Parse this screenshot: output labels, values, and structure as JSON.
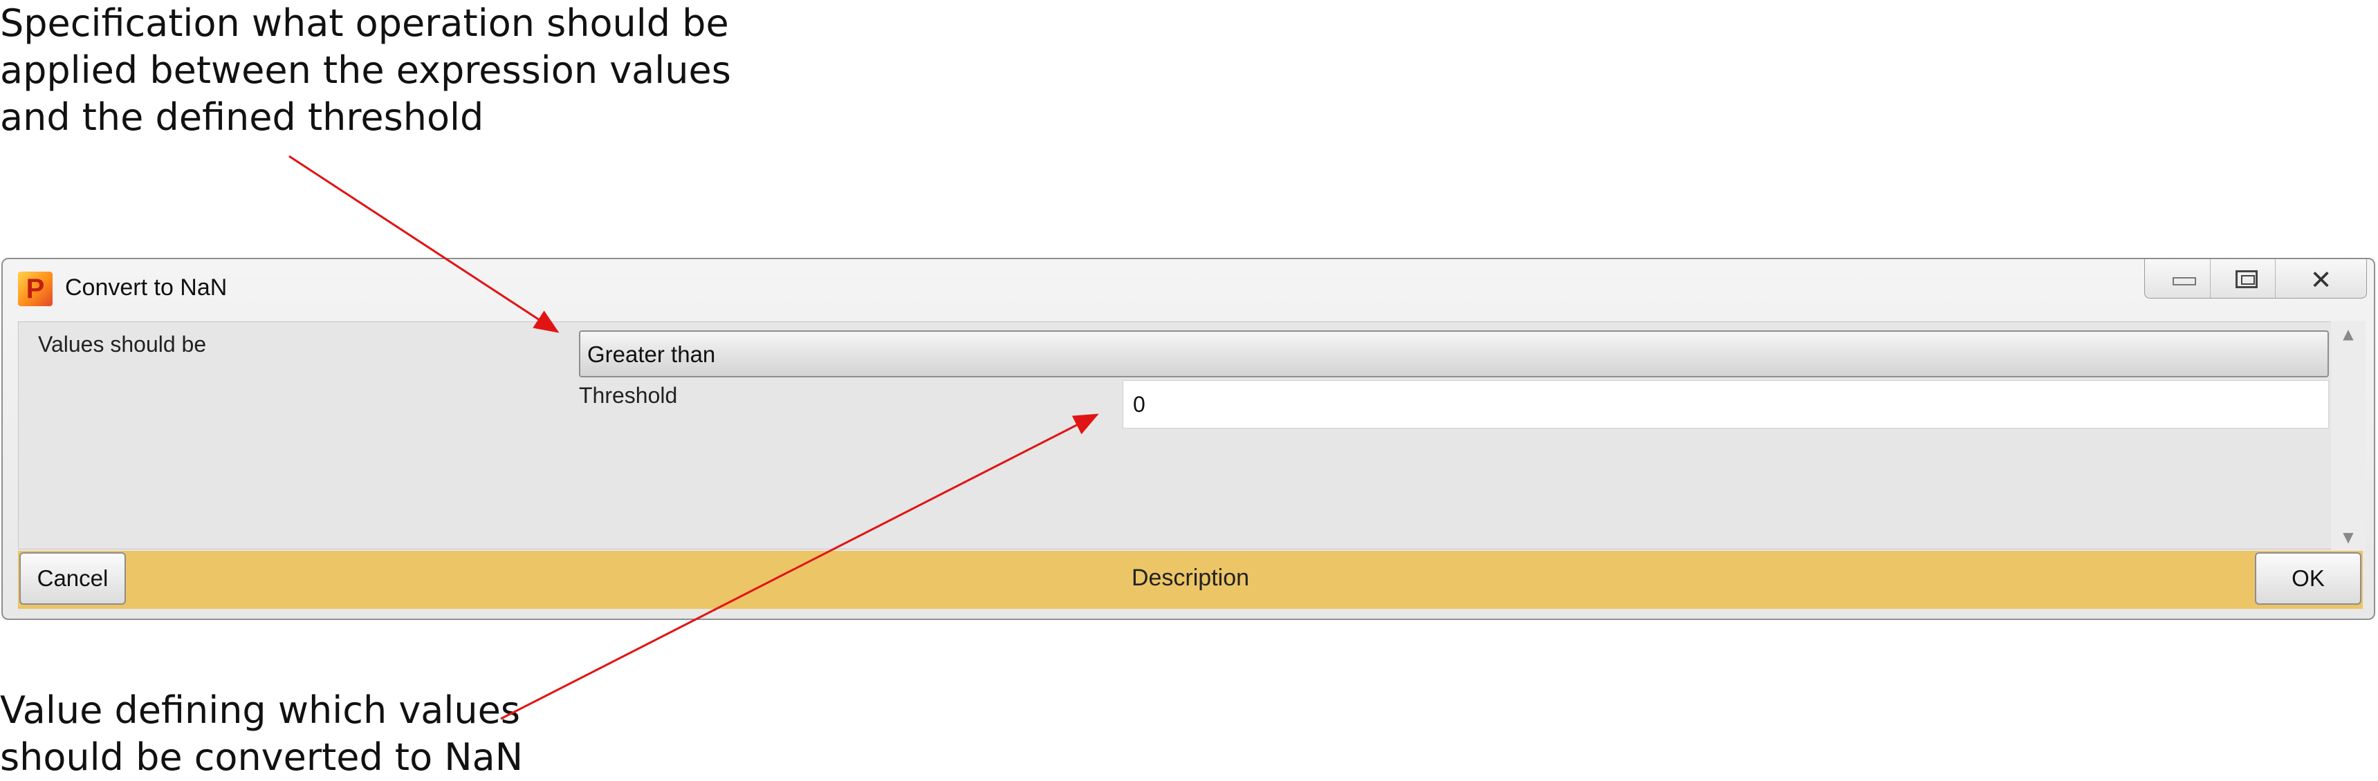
{
  "annotations": {
    "top": [
      "Specification what operation should be",
      "applied between the expression values",
      "and the defined threshold"
    ],
    "bottom": [
      "Value defining which values",
      "should be converted to NaN"
    ]
  },
  "window": {
    "title": "Convert to NaN",
    "icon_name": "app-p-icon",
    "icon_letter": "P",
    "controls": [
      "minimize-icon",
      "restore-icon",
      "close-icon"
    ],
    "close_glyph": "✕"
  },
  "form": {
    "values_label": "Values should be",
    "operation_selected": "Greater than",
    "threshold_label": "Threshold",
    "threshold_value": "0"
  },
  "footer": {
    "cancel_label": "Cancel",
    "description_label": "Description",
    "ok_label": "OK"
  },
  "colors": {
    "footer_bar": "#ecc566",
    "arrow": "#e11414"
  }
}
